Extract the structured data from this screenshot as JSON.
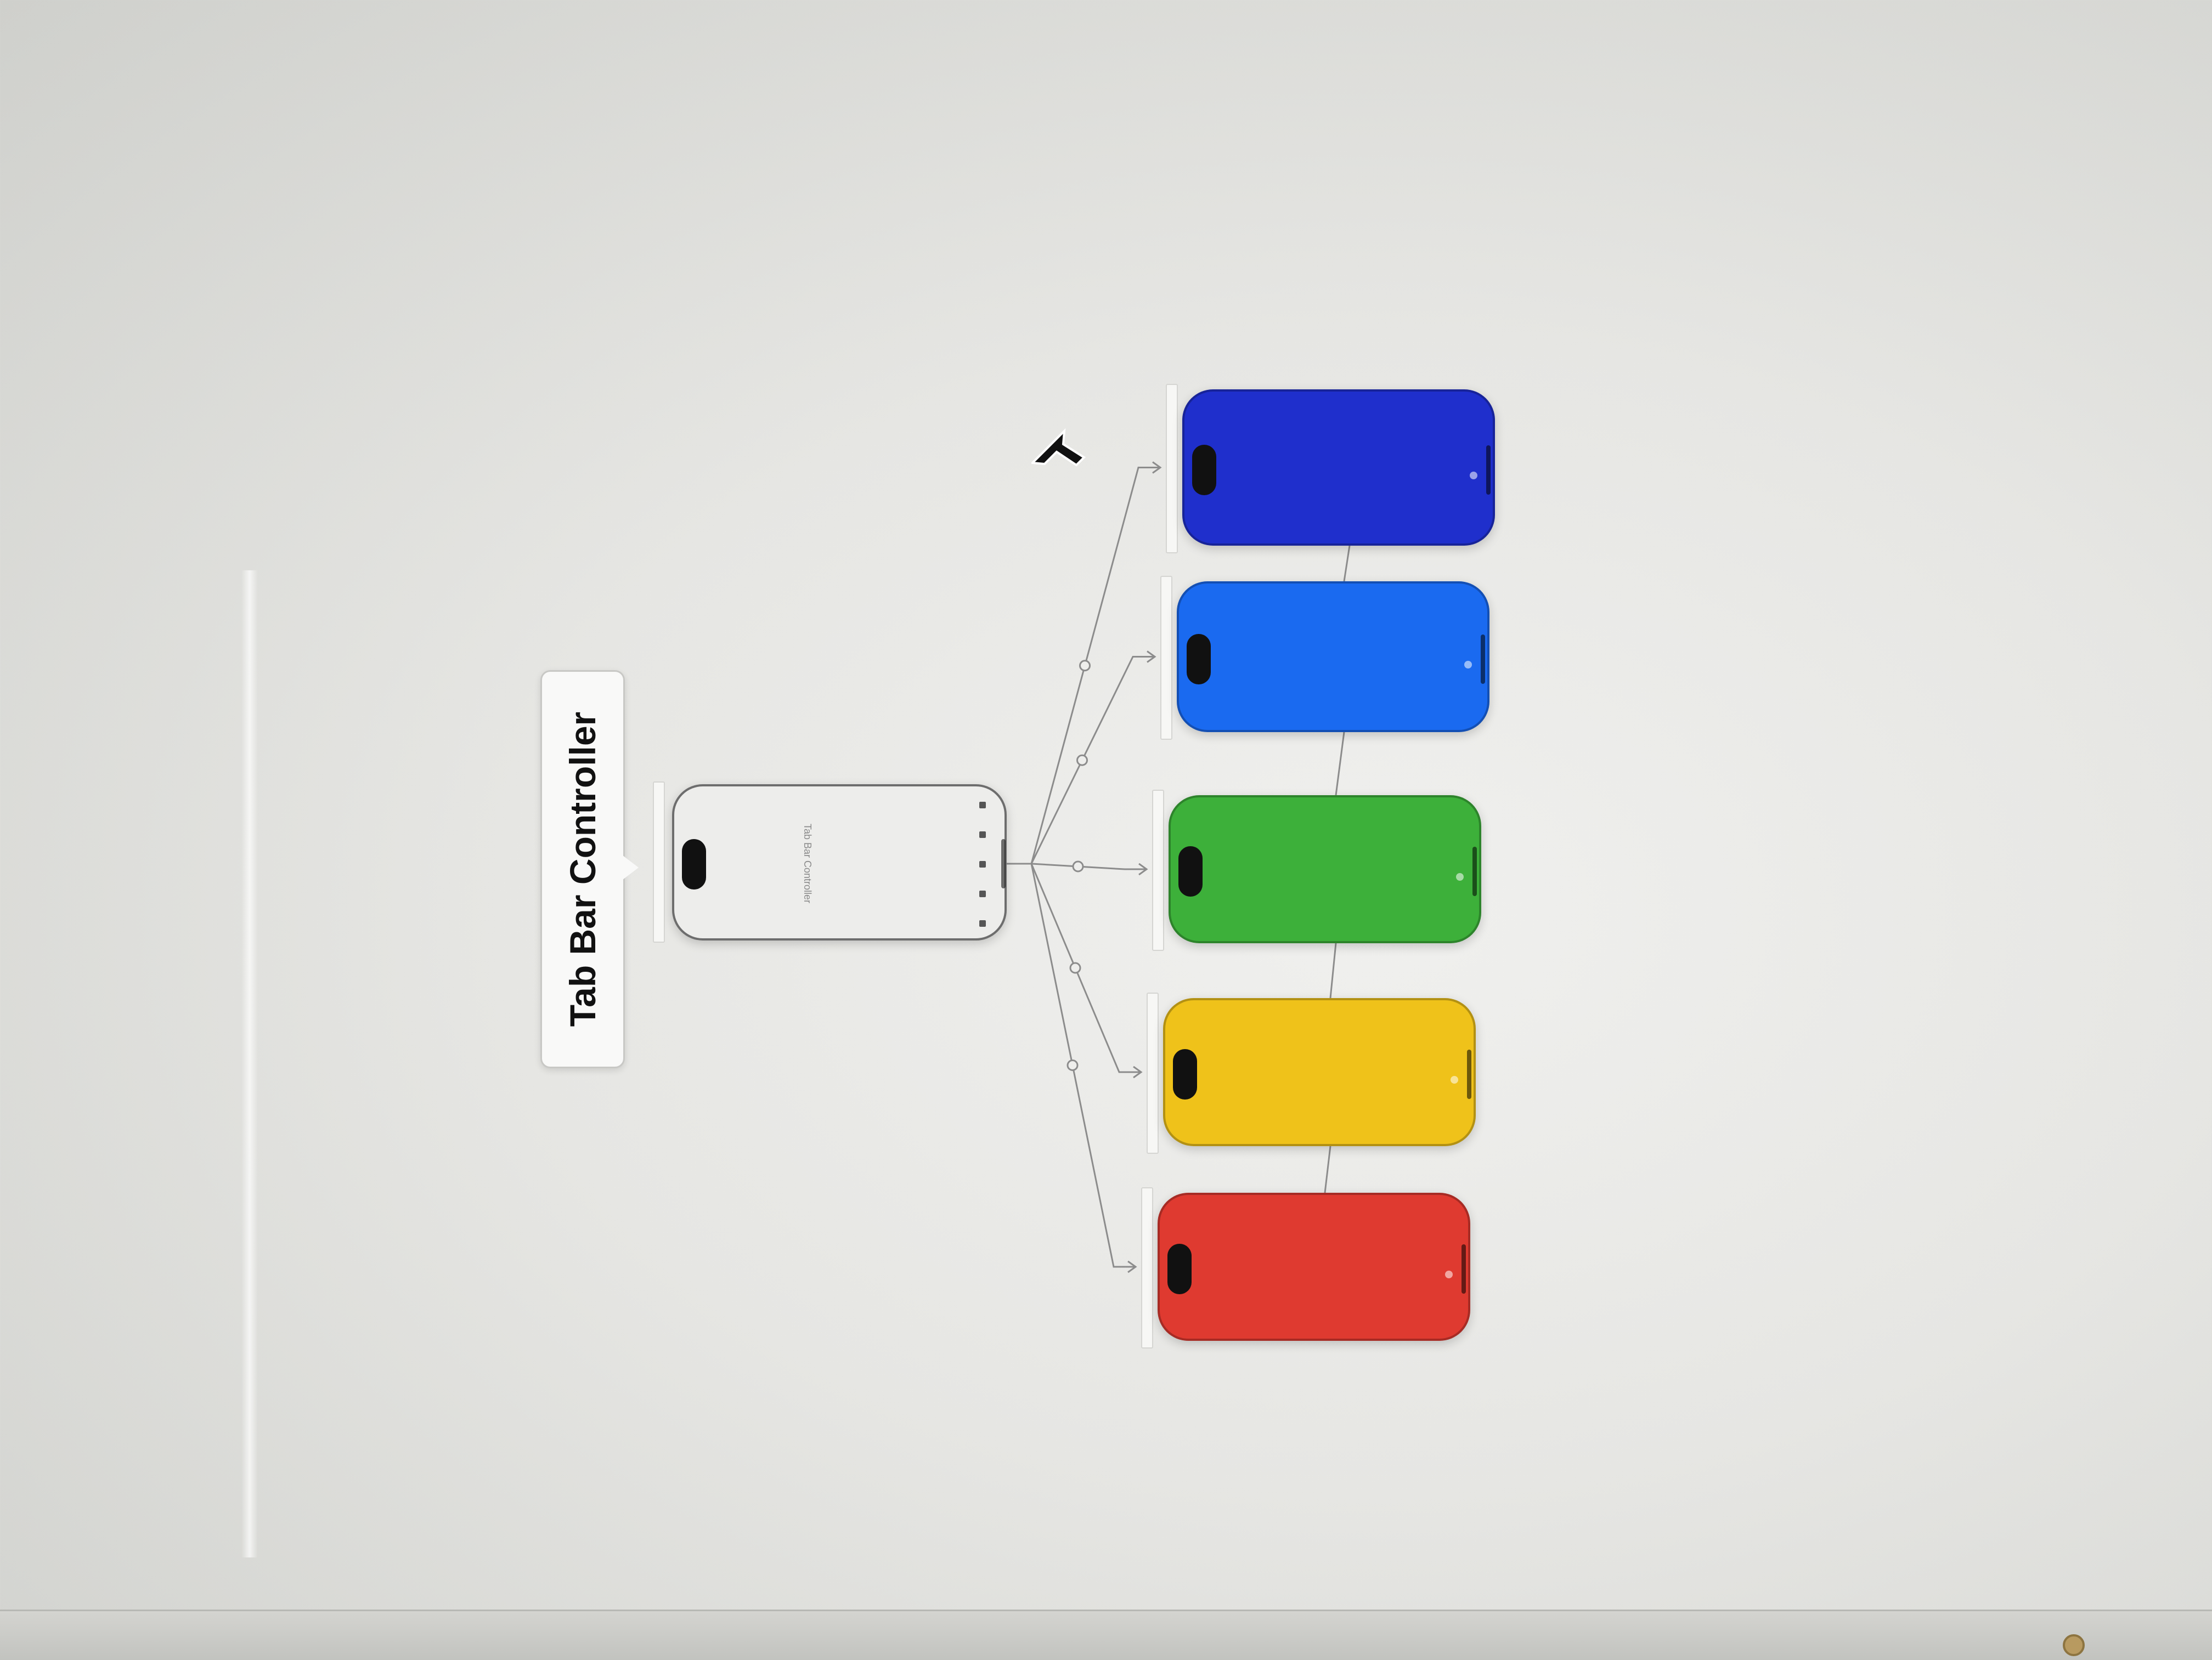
{
  "canvas": {
    "tooltip": {
      "title": "Tab Bar Controller"
    },
    "tab_bar_controller": {
      "title": "Tab Bar Controller",
      "tab_count": 5,
      "fill_color": "#ededeb"
    },
    "child_scenes": [
      {
        "name": "blue-scene",
        "color": "#1f2fcc"
      },
      {
        "name": "light-blue-scene",
        "color": "#1a6af0"
      },
      {
        "name": "green-scene",
        "color": "#3db03a"
      },
      {
        "name": "yellow-scene",
        "color": "#efc21a"
      },
      {
        "name": "red-scene",
        "color": "#df3a30"
      }
    ],
    "connection_line_color": "#8c8c8c",
    "pointer": "mouse-pointer-icon",
    "corner_icon": "gear-icon"
  }
}
